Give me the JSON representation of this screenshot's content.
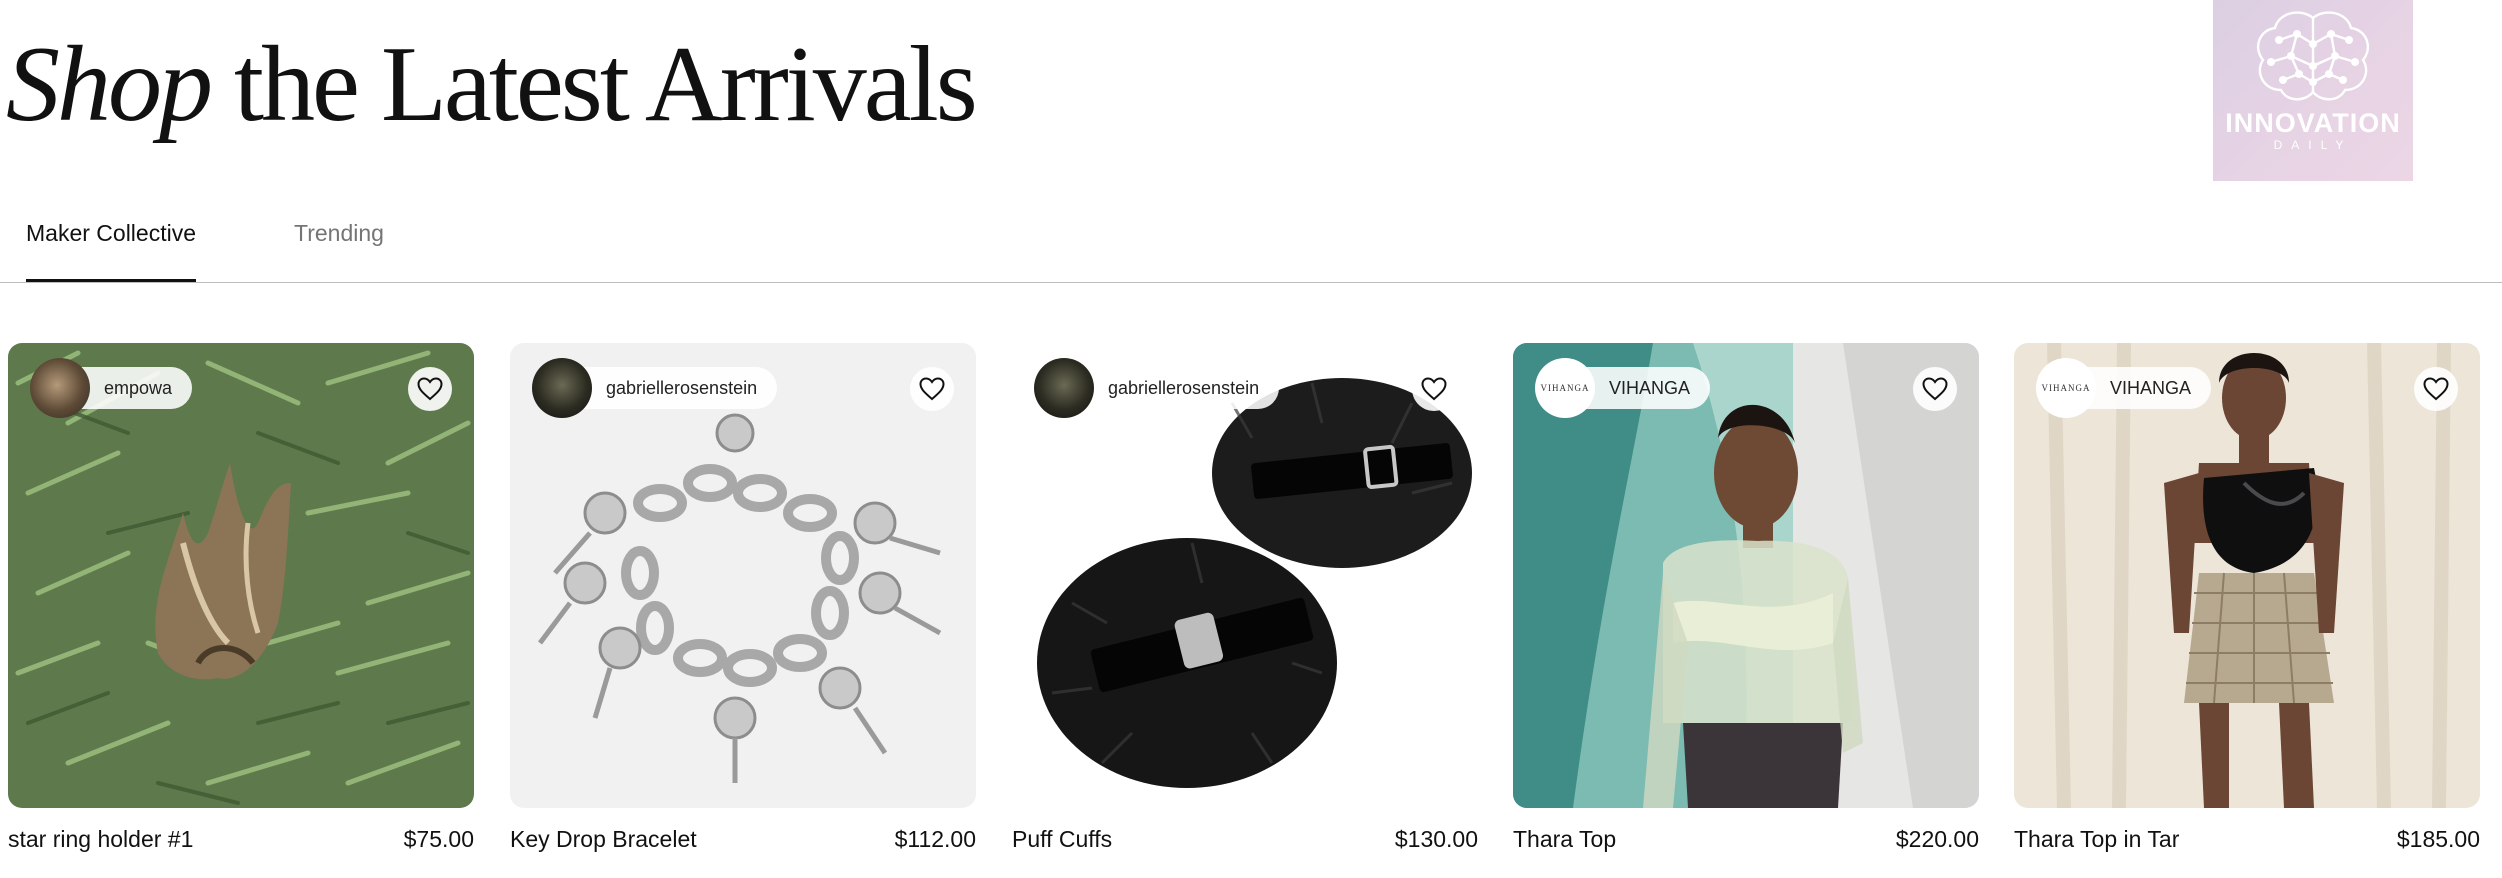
{
  "headline": {
    "italic": "Shop",
    "rest": "the Latest Arrivals"
  },
  "logo": {
    "main": "INNOVATION",
    "sub": "DAILY"
  },
  "tabs": [
    {
      "label": "Maker Collective",
      "active": true
    },
    {
      "label": "Trending",
      "active": false
    }
  ],
  "products": [
    {
      "seller": "empowa",
      "name": "star ring holder #1",
      "price": "$75.00"
    },
    {
      "seller": "gabriellerosenstein",
      "name": "Key Drop Bracelet",
      "price": "$112.00"
    },
    {
      "seller": "gabriellerosenstein",
      "name": "Puff Cuffs",
      "price": "$130.00"
    },
    {
      "seller": "VIHANGA",
      "seller_avatar_text": "VIHANGA",
      "name": "Thara Top",
      "price": "$220.00"
    },
    {
      "seller": "VIHANGA",
      "seller_avatar_text": "VIHANGA",
      "name": "Thara Top in Tar",
      "price": "$185.00"
    }
  ],
  "icons": {
    "favorite": "heart-outline-icon",
    "logo": "brain-network-icon"
  }
}
